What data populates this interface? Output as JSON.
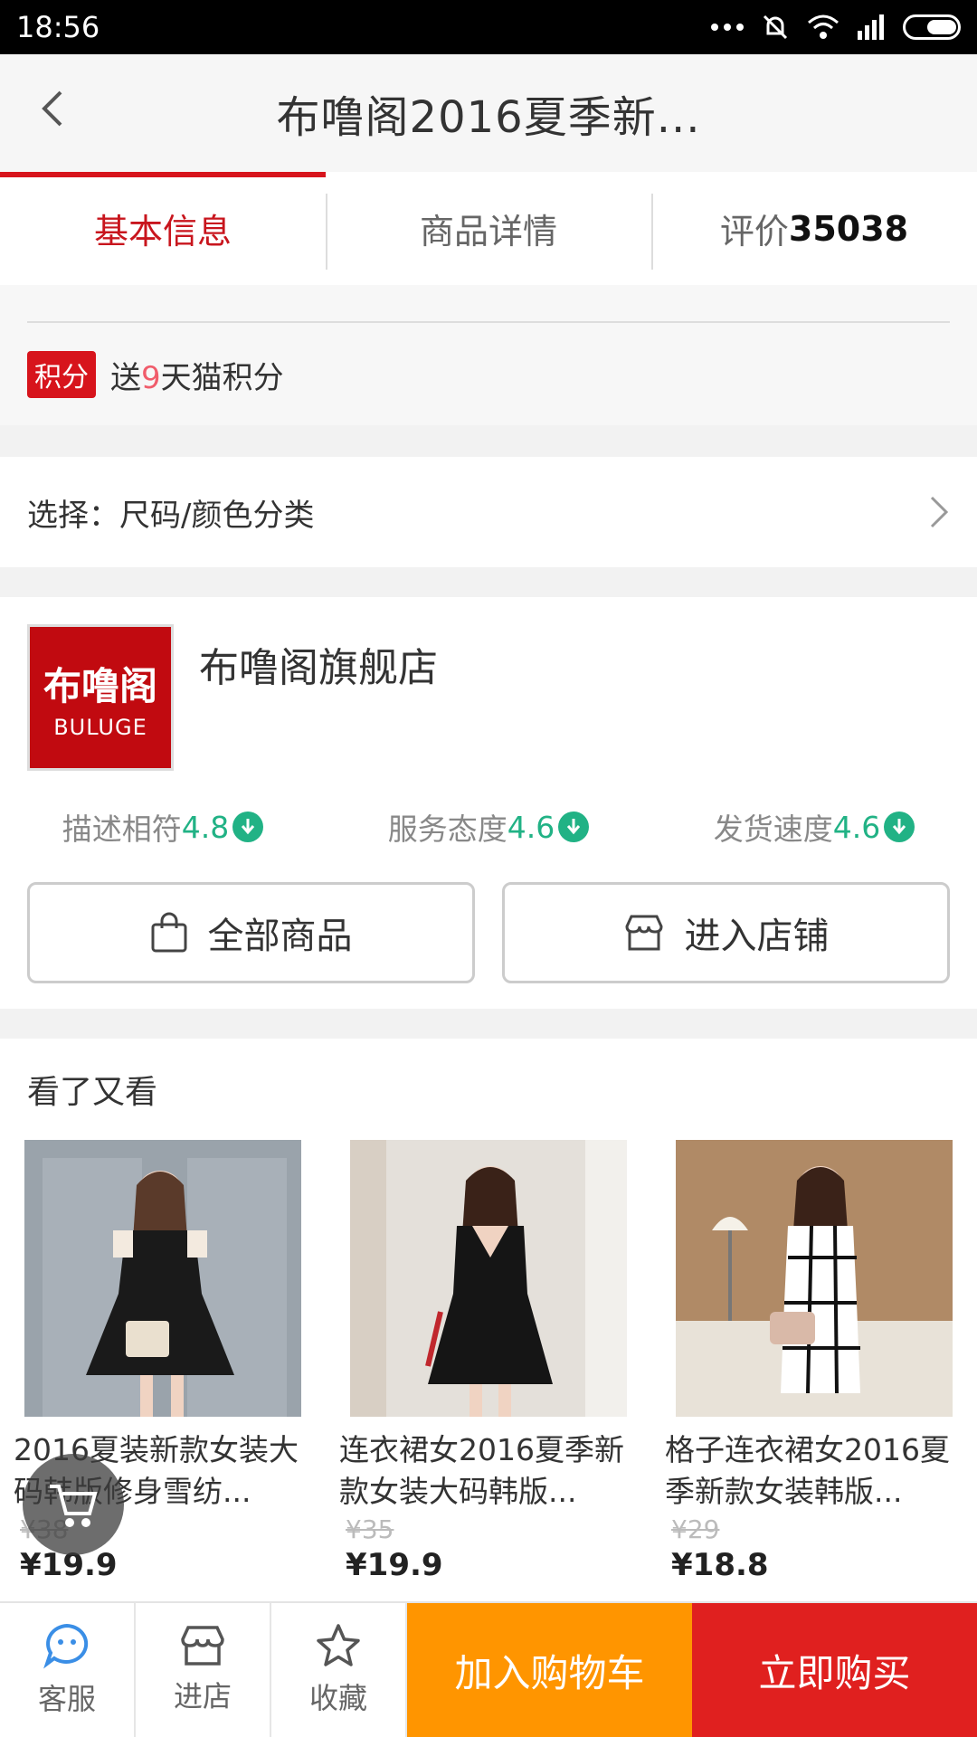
{
  "status_bar": {
    "time": "18:56"
  },
  "nav": {
    "title": "布噜阁2016夏季新..."
  },
  "tabs": [
    {
      "label": "基本信息"
    },
    {
      "label": "商品详情"
    },
    {
      "label": "评价",
      "count": "35038"
    }
  ],
  "points": {
    "tag": "积分",
    "text_prefix": "送",
    "days": "9",
    "text_suffix": "天猫积分"
  },
  "select": {
    "label": "选择：尺码/颜色分类"
  },
  "shop": {
    "logo_cn": "布噜阁",
    "logo_en": "BULUGE",
    "name": "布噜阁旗舰店",
    "ratings": [
      {
        "label": "描述相符",
        "score": "4.8"
      },
      {
        "label": "服务态度",
        "score": "4.6"
      },
      {
        "label": "发货速度",
        "score": "4.6"
      }
    ],
    "buttons": {
      "all_products": "全部商品",
      "enter_shop": "进入店铺"
    }
  },
  "recommend": {
    "heading": "看了又看",
    "products": [
      {
        "title": "2016夏装新款女装大码韩版修身雪纺...",
        "old_price": "¥38",
        "price": "¥19.9"
      },
      {
        "title": "连衣裙女2016夏季新款女装大码韩版...",
        "old_price": "¥35",
        "price": "¥19.9"
      },
      {
        "title": "格子连衣裙女2016夏季新款女装韩版...",
        "old_price": "¥29",
        "price": "¥18.8"
      }
    ]
  },
  "bottom_bar": {
    "service": "客服",
    "shop": "进店",
    "favorite": "收藏",
    "add_to_cart": "加入购物车",
    "buy_now": "立即购买"
  },
  "colors": {
    "accent_red": "#d7141c",
    "orange": "#ff9500",
    "green": "#21b285"
  }
}
